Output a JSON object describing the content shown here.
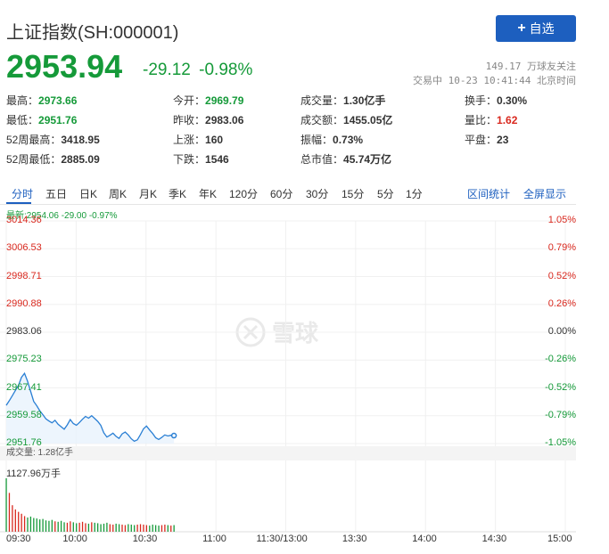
{
  "header": {
    "title": "上证指数(SH:000001)",
    "add_label": "自选",
    "add_icon": "plus-icon"
  },
  "quote": {
    "price": "2953.94",
    "change": "-29.12",
    "change_pct": "-0.98%",
    "followers": "149.17 万球友关注",
    "trade_status": "交易中 10-23 10:41:44 北京时间"
  },
  "stats": {
    "high_k": "最高：",
    "high_v": "2973.66",
    "low_k": "最低：",
    "low_v": "2951.76",
    "w52h_k": "52周最高：",
    "w52h_v": "3418.95",
    "w52l_k": "52周最低：",
    "w52l_v": "2885.09",
    "open_k": "今开：",
    "open_v": "2969.79",
    "prev_k": "昨收：",
    "prev_v": "2983.06",
    "up_k": "上涨：",
    "up_v": "160",
    "down_k": "下跌：",
    "down_v": "1546",
    "vol_k": "成交量：",
    "vol_v": "1.30亿手",
    "amt_k": "成交额：",
    "amt_v": "1455.05亿",
    "amp_k": "振幅：",
    "amp_v": "0.73%",
    "cap_k": "总市值：",
    "cap_v": "45.74万亿",
    "turn_k": "换手：",
    "turn_v": "0.30%",
    "ratio_k": "量比：",
    "ratio_v": "1.62",
    "flat_k": "平盘：",
    "flat_v": "23"
  },
  "tabs": [
    "分时",
    "五日",
    "日K",
    "周K",
    "月K",
    "季K",
    "年K",
    "120分",
    "60分",
    "30分",
    "15分",
    "5分",
    "1分"
  ],
  "tab_links": {
    "stats": "区间统计",
    "fullscreen": "全屏显示"
  },
  "latest_line": "最新:2954.06 -29.00 -0.97%",
  "watermark": "雪球",
  "volume": {
    "label": "成交量: 1.28亿手",
    "max_label": "1127.96万手"
  },
  "colors": {
    "up": "#d9281e",
    "down": "#159a39",
    "line": "#2a7fd4",
    "accent": "#1d5fbf"
  },
  "chart_data": {
    "type": "line",
    "title": "",
    "prev_close": 2983.06,
    "y_labels_left": [
      "3014.36",
      "3006.53",
      "2998.71",
      "2990.88",
      "2983.06",
      "2975.23",
      "2967.41",
      "2959.58",
      "2951.76"
    ],
    "y_labels_right": [
      "1.05%",
      "0.79%",
      "0.52%",
      "0.26%",
      "0.00%",
      "-0.26%",
      "-0.52%",
      "-0.79%",
      "-1.05%"
    ],
    "x_labels": [
      "09:30",
      "10:00",
      "10:30",
      "11:00",
      "11:30/13:00",
      "13:30",
      "14:00",
      "14:30",
      "15:00"
    ],
    "ylim": [
      2951.76,
      3014.36
    ],
    "x_range_minutes": [
      0,
      240
    ],
    "series": [
      {
        "values": [
          2962.5,
          2963.8,
          2965.2,
          2966.7,
          2968.1,
          2970.4,
          2971.5,
          2969.3,
          2966.4,
          2963.6,
          2962.4,
          2961.0,
          2959.9,
          2958.7,
          2958.1,
          2957.6,
          2958.3,
          2957.2,
          2956.5,
          2955.8,
          2957.0,
          2958.5,
          2957.4,
          2956.9,
          2957.7,
          2958.6,
          2959.4,
          2958.9,
          2959.6,
          2958.8,
          2958.0,
          2956.9,
          2954.8,
          2953.6,
          2954.1,
          2954.7,
          2953.8,
          2953.2,
          2954.5,
          2955.0,
          2954.2,
          2953.1,
          2952.4,
          2952.8,
          2954.3,
          2955.9,
          2956.7,
          2955.6,
          2954.6,
          2953.4,
          2952.9,
          2953.5,
          2954.2,
          2953.9,
          2954.1,
          2954.0
        ],
        "note_unit": "index points, one per ~2 minutes from 09:30"
      }
    ],
    "volume_series": [
      1127.96,
      820,
      560,
      470,
      420,
      380,
      330,
      300,
      320,
      290,
      280,
      260,
      270,
      240,
      230,
      250,
      220,
      210,
      230,
      200,
      190,
      220,
      200,
      180,
      190,
      210,
      180,
      170,
      200,
      190,
      180,
      160,
      170,
      190,
      160,
      150,
      170,
      160,
      150,
      140,
      160,
      150,
      140,
      150,
      160,
      150,
      140,
      130,
      150,
      140,
      130,
      140,
      150,
      140,
      130,
      140
    ],
    "volume_max": 1127.96,
    "grid": true
  }
}
